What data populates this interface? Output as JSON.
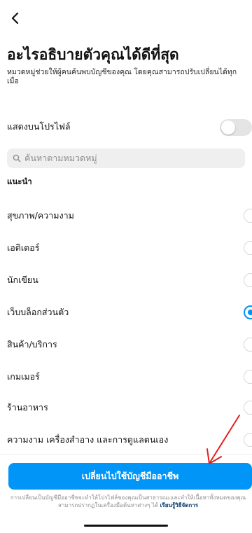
{
  "header": {
    "back_icon": "chevron-left-icon",
    "title": "อะไรอธิบายตัวคุณได้ดีที่สุด",
    "subtitle": "หมวดหมู่ช่วยให้ผู้คนค้นพบบัญชีของคุณ โดยคุณสามารถปรับเปลี่ยนได้ทุกเมื่อ"
  },
  "profile_display": {
    "label": "แสดงบนโปรไฟล์",
    "toggle_on": false
  },
  "search": {
    "icon": "search-icon",
    "placeholder": "ค้นหาตามหมวดหมู่"
  },
  "section_label": "แนะนำ",
  "categories": [
    {
      "label": "สุขภาพ/ความงาม",
      "selected": false
    },
    {
      "label": "เอดิเตอร์",
      "selected": false
    },
    {
      "label": "นักเขียน",
      "selected": false
    },
    {
      "label": "เว็บบล็อกส่วนตัว",
      "selected": true
    },
    {
      "label": "สินค้า/บริการ",
      "selected": false
    },
    {
      "label": "เกมเมอร์",
      "selected": false
    },
    {
      "label": "ร้านอาหาร",
      "selected": false
    },
    {
      "label": "ความงาม เครื่องสำอาง และการดูแลตนเอง",
      "selected": false
    }
  ],
  "cta_label": "เปลี่ยนไปใช้บัญชีมืออาชีพ",
  "footnote": {
    "text": "การเปลี่ยนเป็นบัญชีมืออาชีพจะทำให้โปรไฟล์ของคุณเป็นสาธารณะและทำให้เนื้อหาทั้งหมดของคุณสามารถปรากฏในเครื่องมือค้นหาต่างๆ ได้",
    "link": "เรียนรู้วิธีจัดการ"
  },
  "colors": {
    "accent": "#0095f6",
    "annotation_arrow": "#e02020"
  }
}
